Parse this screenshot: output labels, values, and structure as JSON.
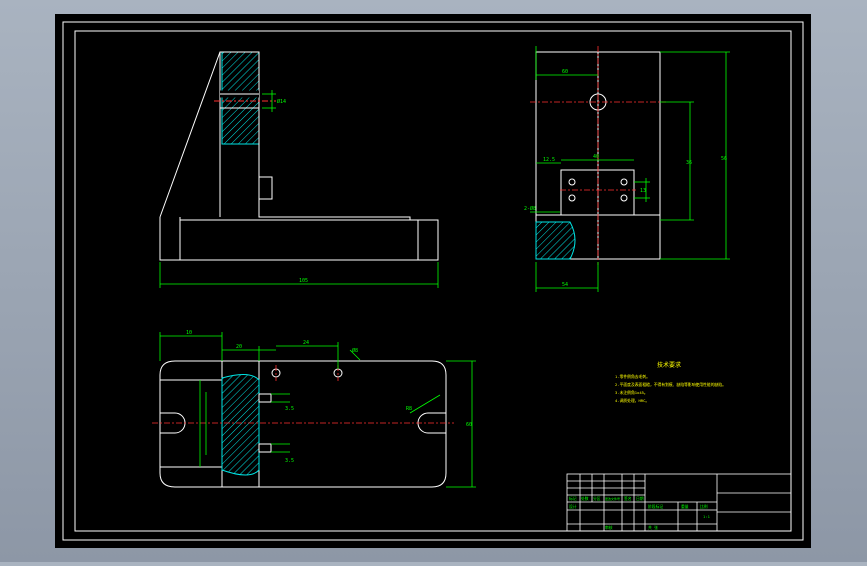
{
  "colors": {
    "background": "#000000",
    "frame": "#ffffff",
    "outline": "#ffffff",
    "dimension": "#00ff00",
    "centerline": "#ff0000",
    "hatch": "#00e5e5",
    "text_note": "#ffff00",
    "window_bg": "#9aa4b2"
  },
  "front_view": {
    "overall_width_dim": "105",
    "bore_dim": "Ø14"
  },
  "side_view": {
    "top_dim": "60",
    "depth_dim": "36",
    "height_dim": "56",
    "slot_width_dim": "40",
    "slot_offset_dim": "12.5",
    "hole_dim": "13",
    "bottom_dim": "54",
    "left_dim": "2-Ø8"
  },
  "top_view": {
    "dim_a": "10",
    "dim_b": "20",
    "dim_c": "24",
    "dim_d": "Ø8",
    "height_dim": "60",
    "slot_dim_1": "3.5",
    "slot_dim_2": "3.5",
    "radius_dim": "R8"
  },
  "tech_requirements": {
    "title": "技术要求",
    "lines": [
      "1.零件倒角去毛刺。",
      "2.平面度及表面粗糙，不得有划痕、缺陷等影响使用性能的缺陷。",
      "3.未注倒角1x45。",
      "4.调质处理，HRC。"
    ]
  },
  "title_block": {
    "row_labels": [
      "标记",
      "处数",
      "分区",
      "更改文件号",
      "签名",
      "日期"
    ],
    "design_label": "设计",
    "approve_label": "审核",
    "stage_label": "阶段标记",
    "weight_label": "重量",
    "scale_label": "比例",
    "scale_value": "1:1",
    "sheet_label": "共 张",
    "part_name": "",
    "drawing_number": ""
  }
}
